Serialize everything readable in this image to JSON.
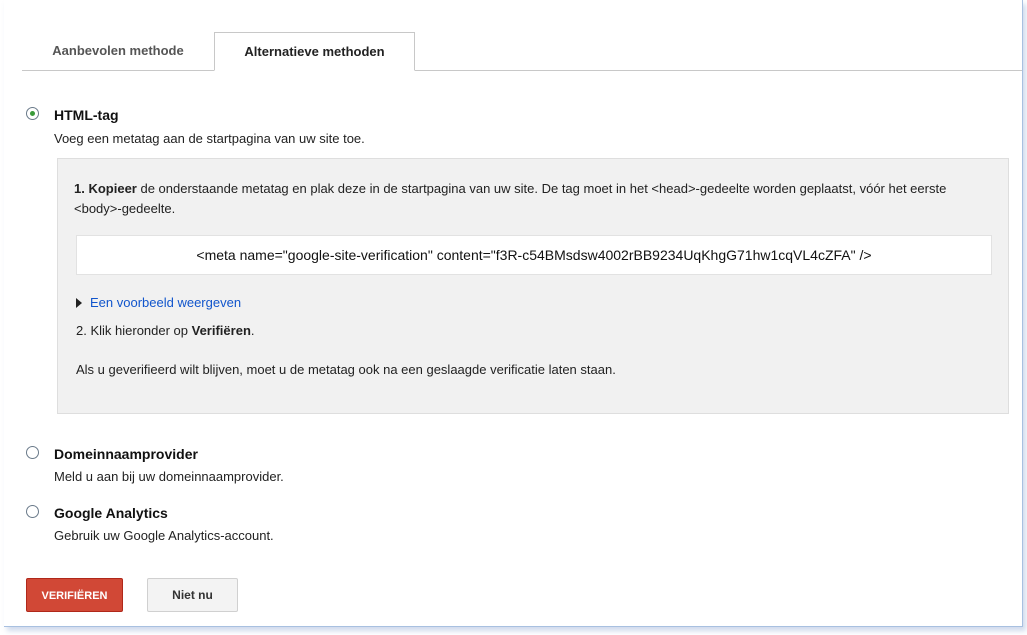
{
  "tabs": [
    {
      "label": "Aanbevolen methode",
      "active": false
    },
    {
      "label": "Alternatieve methoden",
      "active": true
    }
  ],
  "options": [
    {
      "title": "HTML-tag",
      "description": "Voeg een metatag aan de startpagina van uw site toe.",
      "selected": true
    },
    {
      "title": "Domeinnaamprovider",
      "description": "Meld u aan bij uw domeinnaamprovider.",
      "selected": false
    },
    {
      "title": "Google Analytics",
      "description": "Gebruik uw Google Analytics-account.",
      "selected": false
    }
  ],
  "panel": {
    "step1_number": "1.",
    "step1_bold": "Kopieer",
    "step1_text": " de onderstaande metatag en plak deze in de startpagina van uw site. De tag moet in het <head>-gedeelte worden geplaatst, vóór het eerste <body>-gedeelte.",
    "meta_tag": "<meta name=\"google-site-verification\" content=\"f3R-c54BMsdsw4002rBB9234UqKhgG71hw1cqVL4cZFA\" />",
    "example_link": "Een voorbeeld weergeven",
    "step2_text": "2. Klik hieronder op ",
    "step2_bold": "Verifiëren",
    "step2_end": ".",
    "note": "Als u geverifieerd wilt blijven, moet u de metatag ook na een geslaagde verificatie laten staan."
  },
  "buttons": {
    "verify": "VERIFIËREN",
    "later": "Niet nu"
  },
  "colors": {
    "verify_button": "#d14836",
    "link": "#1155cc",
    "radio_selected": "#3a9a3a"
  }
}
